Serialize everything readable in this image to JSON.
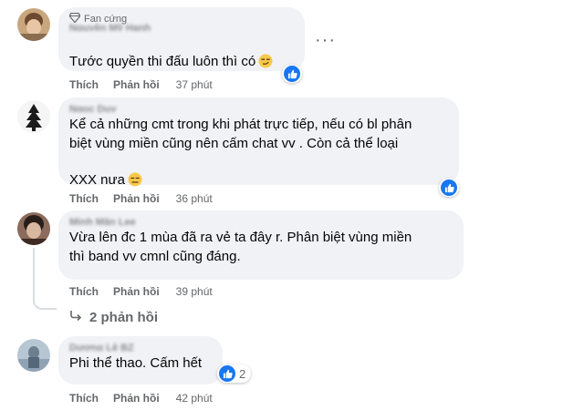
{
  "comments": [
    {
      "badge": "Fan cứng",
      "name": "Nguyễn Mỹ Hạnh",
      "text": "Tước quyền thi đấu luôn thì có",
      "emoji": "smirk",
      "like_label": "Thích",
      "reply_label": "Phản hồi",
      "time": "37 phút",
      "reactions": {
        "icon": "like",
        "count": ""
      }
    },
    {
      "name": "Ngọc Duy",
      "text": "Kể cả những cmt trong khi phát trực tiếp, nếu có bl phân\nbiệt vùng miền cũng nên cấm chat vv . Còn cả thể loại\nXXX nưa",
      "emoji": "expressionless",
      "like_label": "Thích",
      "reply_label": "Phản hồi",
      "time": "36 phút",
      "reactions": {
        "icon": "like",
        "count": ""
      }
    },
    {
      "name": "Minh Mẫn Lee",
      "text": "Vừa lên đc 1 mùa đã ra vẻ ta đây r. Phân biệt vùng miền\nthì band vv cmnl cũng đáng.",
      "like_label": "Thích",
      "reply_label": "Phản hồi",
      "time": "39 phút",
      "replies": "2 phản hồi"
    },
    {
      "name": "Dương Lê BZ",
      "text": "Phi thể thao. Cấm hết",
      "like_label": "Thích",
      "reply_label": "Phản hồi",
      "time": "42 phút",
      "reactions": {
        "icon": "like",
        "count": "2"
      }
    }
  ],
  "colors": {
    "like_blue": "#1877f2",
    "bubble": "#f0f2f5",
    "meta": "#65676b"
  }
}
